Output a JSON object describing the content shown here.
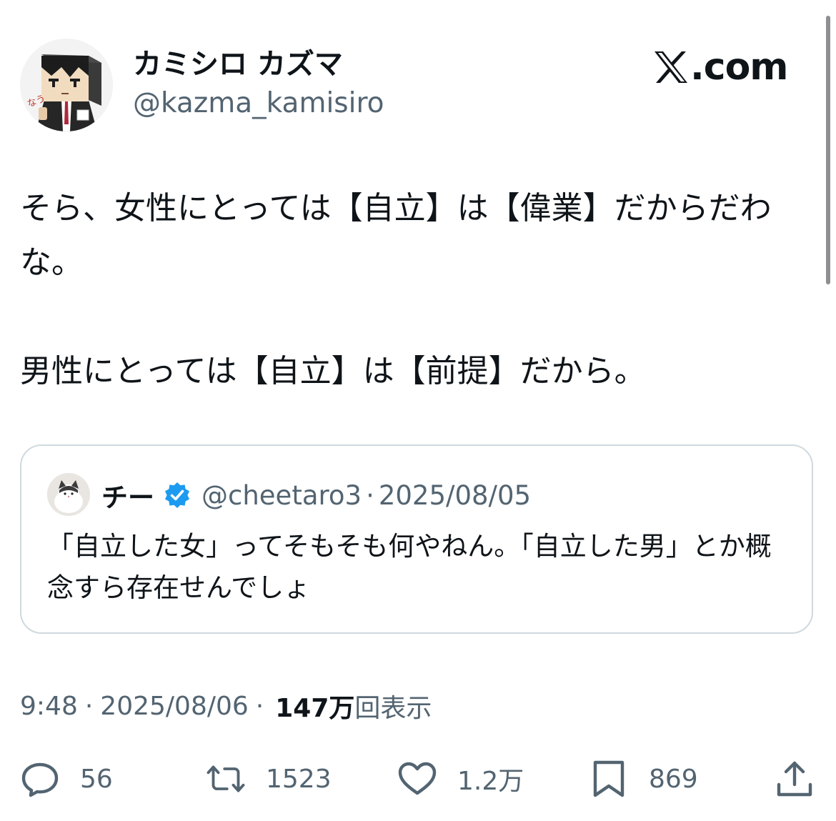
{
  "author": {
    "display_name": "カミシロ カズマ",
    "handle": "@kazma_kamisiro",
    "avatar_text": "なう"
  },
  "brand": {
    "text": ".com",
    "icon": "x-logo-icon"
  },
  "tweet": {
    "text": "そら、女性にとっては【自立】は【偉業】だからだわな。\n\n男性にとっては【自立】は【前提】だから。"
  },
  "quote": {
    "name": "チー",
    "handle": "@cheetaro3",
    "separator": "·",
    "date": "2025/08/05",
    "text": "「自立した女」ってそもそも何やねん。「自立した男」とか概念すら存在せんでしょ",
    "verified_color": "#1d9bf0"
  },
  "meta": {
    "time": "9:48",
    "separator": "·",
    "date": "2025/08/06",
    "views_count": "147万",
    "views_label": "回表示"
  },
  "actions": {
    "replies": "56",
    "retweets": "1523",
    "likes": "1.2万",
    "bookmarks": "869"
  },
  "colors": {
    "text": "#0f1419",
    "secondary": "#536471",
    "border": "#cfd9de",
    "verified": "#1d9bf0"
  }
}
